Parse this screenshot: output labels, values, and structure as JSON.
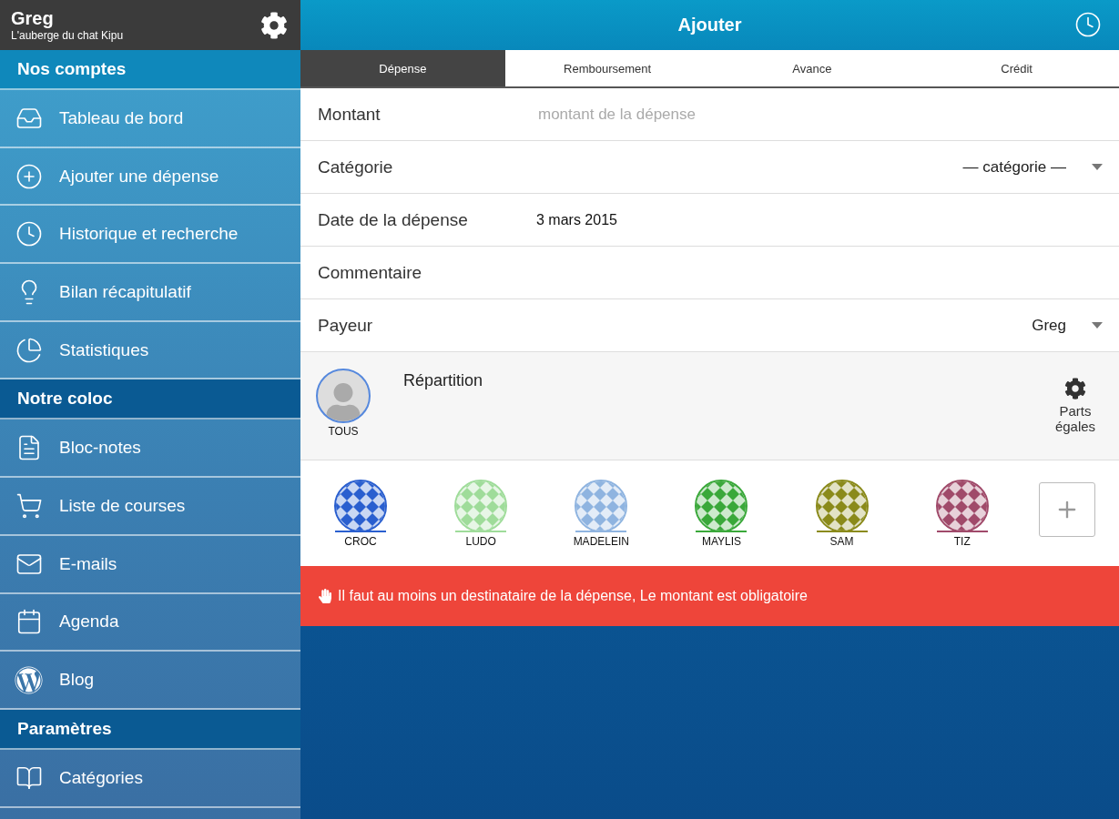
{
  "sidebar": {
    "user": "Greg",
    "group": "L'auberge du chat Kipu",
    "sections": [
      {
        "title": "Nos comptes",
        "items": [
          {
            "label": "Tableau de bord"
          },
          {
            "label": "Ajouter une dépense"
          },
          {
            "label": "Historique et recherche"
          },
          {
            "label": "Bilan récapitulatif"
          },
          {
            "label": "Statistiques"
          }
        ]
      },
      {
        "title": "Notre coloc",
        "items": [
          {
            "label": "Bloc-notes"
          },
          {
            "label": "Liste de courses"
          },
          {
            "label": "E-mails"
          },
          {
            "label": "Agenda"
          },
          {
            "label": "Blog"
          }
        ]
      },
      {
        "title": "Paramètres",
        "items": [
          {
            "label": "Catégories"
          }
        ]
      }
    ]
  },
  "header": {
    "title": "Ajouter"
  },
  "tabs": [
    {
      "label": "Dépense",
      "selected": true
    },
    {
      "label": "Remboursement",
      "selected": false
    },
    {
      "label": "Avance",
      "selected": false
    },
    {
      "label": "Crédit",
      "selected": false
    }
  ],
  "form": [
    {
      "kind": "input",
      "label": "Montant",
      "placeholder": "montant de la dépense"
    },
    {
      "kind": "dropdown",
      "label": "Catégorie",
      "value": "— catégorie —"
    },
    {
      "kind": "text",
      "label": "Date de la dépense",
      "value": "3 mars 2015"
    },
    {
      "kind": "input",
      "label": "Commentaire"
    },
    {
      "kind": "dropdown",
      "label": "Payeur",
      "value": "Greg"
    }
  ],
  "split": {
    "all_label": "TOUS",
    "title": "Répartition",
    "mode_label": "Parts égales"
  },
  "members": [
    {
      "name": "CROC",
      "color": "#2a5fcf"
    },
    {
      "name": "LUDO",
      "color": "#9fdc9a"
    },
    {
      "name": "MADELEIN",
      "color": "#8fb4e0"
    },
    {
      "name": "MAYLIS",
      "color": "#3aa83a"
    },
    {
      "name": "SAM",
      "color": "#8a8a1a"
    },
    {
      "name": "TIZ",
      "color": "#a04a6a"
    }
  ],
  "error": "Il faut au moins un destinataire de la dépense, Le montant est obligatoire"
}
